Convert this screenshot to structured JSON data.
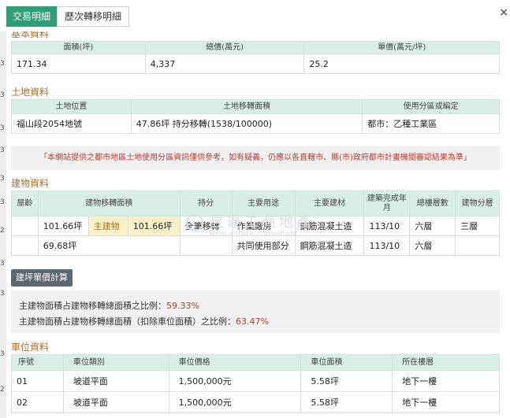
{
  "tabs": [
    {
      "label": "交易明細"
    },
    {
      "label": "歷次轉移明細"
    }
  ],
  "close_label": "×",
  "left_marks": [
    "3",
    "3",
    "3",
    "3",
    "3",
    "3",
    "2",
    "3",
    "3",
    "3",
    "2"
  ],
  "basic": {
    "title": "基本資料",
    "headers": [
      "面積(坪)",
      "總價(萬元)",
      "單價(萬元/坪)"
    ],
    "values": [
      "171.34",
      "4,337",
      "25.2"
    ]
  },
  "land": {
    "title": "土地資料",
    "headers": [
      "土地位置",
      "土地移轉面積",
      "使用分區或編定"
    ],
    "values": [
      "福山段2054地號",
      "47.86坪 持分移轉(1538/100000)",
      "都市：乙種工業區"
    ]
  },
  "notice": "「本網站提供之都市地區土地使用分區資訊僅供參考，如有疑義，仍應以各直轄市、縣(市)政府都市計畫機關審認結果為準」",
  "building": {
    "title": "建物資料",
    "headers": [
      "屋齡",
      "建物移轉面積",
      "持分",
      "主要用途",
      "主要建材",
      "建築完成年月",
      "總樓層數",
      "建物分層"
    ],
    "rows": [
      {
        "age": "",
        "area": "101.66坪",
        "main_label": "主建物",
        "main_area": "101.66坪",
        "share": "全筆移轉",
        "usage": "作業廠房",
        "material": "鋼筋混凝土造",
        "completed": "113/10",
        "floors": "六層",
        "level": "三層"
      },
      {
        "age": "",
        "area": "69.68坪",
        "main_label": "",
        "main_area": "",
        "share": "",
        "usage": "共同使用部分",
        "material": "鋼筋混凝土造",
        "completed": "113/10",
        "floors": "六層",
        "level": ""
      }
    ]
  },
  "calc_button": "建坪單價計算",
  "ratios": [
    {
      "label": "主建物面積占建物移轉總面積之比例：",
      "value": "59.33%"
    },
    {
      "label": "主建物面積占建物移轉總面積（扣除車位面積）之比例：",
      "value": "63.47%"
    }
  ],
  "parking": {
    "title": "車位資料",
    "headers": [
      "序號",
      "車位類別",
      "車位價格",
      "車位面積",
      "所在樓層"
    ],
    "rows": [
      [
        "01",
        "坡道平面",
        "1,500,000元",
        "5.58坪",
        "地下一樓"
      ],
      [
        "02",
        "坡道平面",
        "1,500,000元",
        "5.58坪",
        "地下一樓"
      ]
    ]
  },
  "watermark": {
    "main": "昱達工商地產",
    "sub": "Real estate consultant"
  },
  "colors": {
    "accent": "#2f9e77",
    "header_bg": "#d9efe5",
    "section_title": "#b07020",
    "alert": "#c0392b",
    "highlight": "#fbf1c9"
  }
}
